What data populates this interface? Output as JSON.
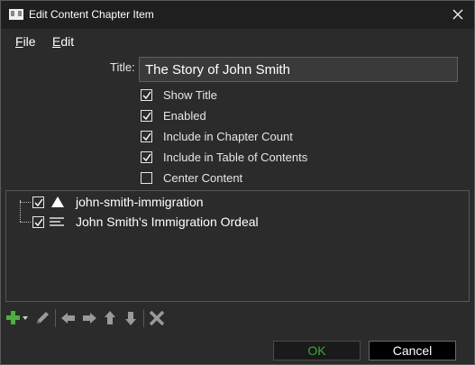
{
  "window": {
    "title": "Edit Content Chapter Item",
    "app_icon": "book-icon",
    "close_icon": "close-icon"
  },
  "menu": {
    "items": [
      {
        "label": "File"
      },
      {
        "label": "Edit"
      }
    ]
  },
  "form": {
    "title_label": "Title:",
    "title_value": "The Story of John Smith",
    "checkboxes": [
      {
        "label": "Show Title",
        "checked": true
      },
      {
        "label": "Enabled",
        "checked": true
      },
      {
        "label": "Include in Chapter Count",
        "checked": true
      },
      {
        "label": "Include in Table of Contents",
        "checked": true
      },
      {
        "label": "Center Content",
        "checked": false
      }
    ]
  },
  "tree": {
    "items": [
      {
        "label": "john-smith-immigration",
        "checked": true,
        "icon": "triangle-icon"
      },
      {
        "label": "John Smith's Immigration Ordeal",
        "checked": true,
        "icon": "text-lines-icon"
      }
    ]
  },
  "toolbar": {
    "icons": [
      "add-icon",
      "dropdown-arrow-icon",
      "edit-pencil-icon",
      "move-left-icon",
      "move-right-icon",
      "move-up-icon",
      "move-down-icon",
      "delete-icon"
    ]
  },
  "buttons": {
    "ok": "OK",
    "cancel": "Cancel"
  },
  "colors": {
    "background": "#2b2b2b",
    "titlebar": "#1f1f1f",
    "ok_text": "#3aa83a",
    "add_green": "#4caf3f"
  }
}
